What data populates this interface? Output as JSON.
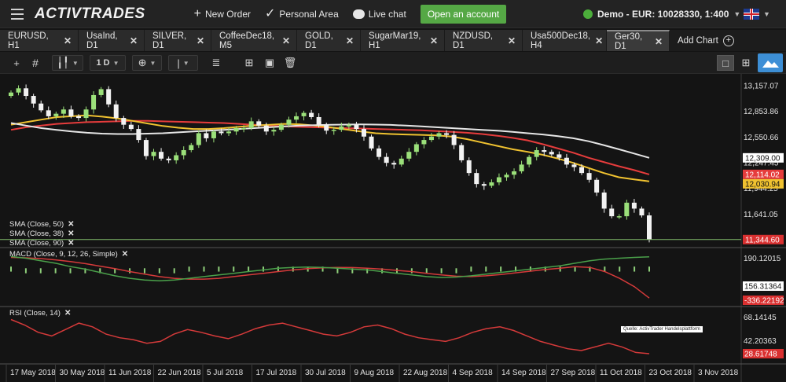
{
  "topbar": {
    "logo": "ACTIVTRADES",
    "new_order": "New Order",
    "personal_area": "Personal Area",
    "live_chat": "Live chat",
    "open_account": "Open an account",
    "account": "Demo - EUR: 10028330, 1:400"
  },
  "tabs": [
    {
      "label": "EURUSD, H1"
    },
    {
      "label": "UsaInd, D1"
    },
    {
      "label": "SILVER, D1"
    },
    {
      "label": "CoffeeDec18, M5"
    },
    {
      "label": "GOLD, D1"
    },
    {
      "label": "SugarMar19, H1"
    },
    {
      "label": "NZDUSD, D1"
    },
    {
      "label": "Usa500Dec18, H4"
    },
    {
      "label": "Ger30, D1"
    }
  ],
  "add_chart": "Add Chart",
  "toolbar": {
    "timeframe": "1 D"
  },
  "legends": {
    "sma50": "SMA (Close, 50)",
    "sma38": "SMA (Close, 38)",
    "sma90": "SMA (Close, 90)",
    "macd": "MACD (Close, 9, 12, 26, Simple)",
    "rsi": "RSI (Close, 14)"
  },
  "watermark": "Quelle: ActivTrader Handelsplattform",
  "colors": {
    "candle_up": "#9be07a",
    "candle_down": "#f2f2f2",
    "sma50": "#e63c3c",
    "sma38": "#f0c230",
    "sma90": "#e6e6e6",
    "macd_line": "#4aa04a",
    "signal_line": "#d53a3a",
    "histogram": "#8fd07a",
    "rsi_line": "#d53a3a",
    "price_line": "#7fb86a"
  },
  "chart_data": {
    "type": "line",
    "title": "Ger30, D1",
    "x_ticks": [
      "17 May 2018",
      "30 May 2018",
      "11 Jun 2018",
      "22 Jun 2018",
      "5 Jul 2018",
      "17 Jul 2018",
      "30 Jul 2018",
      "9 Aug 2018",
      "22 Aug 2018",
      "4 Sep 2018",
      "14 Sep 2018",
      "27 Sep 2018",
      "11 Oct 2018",
      "23 Oct 2018",
      "3 Nov 2018"
    ],
    "price_axis": {
      "ticks": [
        "13,157.07",
        "12,853.86",
        "12,550.66",
        "12,247.45",
        "11,944.25",
        "11,641.05"
      ],
      "ylim": [
        11250,
        13300
      ]
    },
    "price_badges": [
      {
        "label": "12,309.00",
        "series": "SMA (Close, 90)"
      },
      {
        "label": "12,114.02",
        "series": "SMA (Close, 50)"
      },
      {
        "label": "12,030.94",
        "series": "SMA (Close, 38)"
      },
      {
        "label": "11,344.60",
        "series": "Last price"
      }
    ],
    "closes": [
      13080,
      13130,
      13040,
      12950,
      12870,
      12800,
      12830,
      12880,
      12800,
      12780,
      12880,
      13050,
      13120,
      12940,
      12780,
      12700,
      12650,
      12520,
      12330,
      12380,
      12300,
      12280,
      12340,
      12400,
      12460,
      12600,
      12540,
      12620,
      12600,
      12620,
      12660,
      12660,
      12740,
      12690,
      12620,
      12640,
      12700,
      12760,
      12800,
      12840,
      12790,
      12700,
      12630,
      12640,
      12680,
      12700,
      12650,
      12560,
      12420,
      12320,
      12250,
      12230,
      12300,
      12380,
      12470,
      12520,
      12560,
      12600,
      12580,
      12460,
      12280,
      12130,
      12000,
      11980,
      12020,
      12080,
      12110,
      12150,
      12230,
      12320,
      12400,
      12380,
      12350,
      12310,
      12230,
      12200,
      12130,
      12050,
      11900,
      11710,
      11620,
      11620,
      11780,
      11710,
      11630,
      11344.6
    ],
    "series": [
      {
        "name": "SMA (Close, 50)",
        "values": [
          12640,
          12670,
          12690,
          12710,
          12720,
          12730,
          12735,
          12740,
          12745,
          12745,
          12740,
          12735,
          12730,
          12725,
          12720,
          12710,
          12700,
          12690,
          12680,
          12675,
          12670,
          12665,
          12660,
          12655,
          12650,
          12645,
          12640,
          12635,
          12625,
          12615,
          12605,
          12590,
          12570,
          12545,
          12515,
          12470,
          12420,
          12370,
          12310,
          12260,
          12210,
          12165,
          12114.02
        ]
      },
      {
        "name": "SMA (Close, 38)",
        "values": [
          12700,
          12730,
          12760,
          12790,
          12800,
          12810,
          12795,
          12775,
          12745,
          12715,
          12685,
          12665,
          12650,
          12650,
          12660,
          12675,
          12690,
          12700,
          12710,
          12705,
          12690,
          12670,
          12645,
          12620,
          12600,
          12590,
          12585,
          12580,
          12575,
          12560,
          12530,
          12490,
          12450,
          12410,
          12380,
          12345,
          12300,
          12250,
          12190,
          12130,
          12080,
          12055,
          12030.94
        ]
      },
      {
        "name": "SMA (Close, 90)",
        "values": [
          12720,
          12690,
          12660,
          12640,
          12620,
          12605,
          12595,
          12590,
          12590,
          12595,
          12600,
          12610,
          12620,
          12630,
          12640,
          12650,
          12660,
          12670,
          12680,
          12690,
          12695,
          12700,
          12702,
          12704,
          12702,
          12698,
          12690,
          12680,
          12670,
          12660,
          12650,
          12640,
          12630,
          12615,
          12600,
          12585,
          12565,
          12540,
          12505,
          12460,
          12410,
          12360,
          12309.0
        ]
      }
    ],
    "macd_axis": {
      "ticks": [
        "190.12015",
        "156.31364",
        "-336.22192"
      ]
    },
    "macd_series": [
      {
        "name": "MACD",
        "values": [
          160,
          140,
          110,
          80,
          40,
          10,
          -30,
          -70,
          -100,
          -120,
          -130,
          -120,
          -100,
          -80,
          -60,
          -40,
          -20,
          0,
          20,
          30,
          35,
          30,
          20,
          10,
          0,
          -20,
          -40,
          -60,
          -80,
          -90,
          -85,
          -70,
          -50,
          -30,
          -10,
          10,
          30,
          50,
          80,
          110,
          130,
          140,
          150,
          156
        ]
      },
      {
        "name": "Signal",
        "values": [
          150,
          145,
          135,
          120,
          100,
          75,
          45,
          15,
          -20,
          -50,
          -80,
          -100,
          -110,
          -110,
          -100,
          -80,
          -60,
          -40,
          -20,
          0,
          15,
          25,
          30,
          28,
          20,
          10,
          -5,
          -20,
          -40,
          -60,
          -75,
          -80,
          -70,
          -55,
          -35,
          -15,
          5,
          20,
          40,
          30,
          -20,
          -100,
          -200,
          -336.22
        ]
      }
    ],
    "rsi_axis": {
      "ticks": [
        "68.14145",
        "42.20363",
        "28.61748"
      ]
    },
    "rsi_values": [
      66,
      60,
      52,
      48,
      55,
      62,
      58,
      50,
      46,
      44,
      40,
      42,
      50,
      55,
      52,
      48,
      45,
      50,
      56,
      60,
      62,
      58,
      54,
      50,
      48,
      52,
      58,
      60,
      56,
      50,
      46,
      44,
      42,
      46,
      52,
      56,
      58,
      54,
      48,
      42,
      38,
      34,
      32,
      36,
      40,
      36,
      30,
      28.6
    ]
  }
}
